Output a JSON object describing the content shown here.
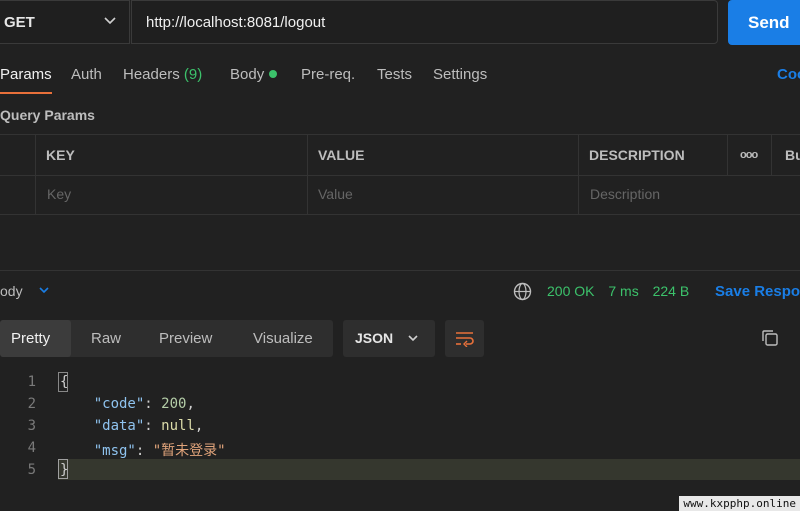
{
  "request": {
    "method": "GET",
    "url": "http://localhost:8081/logout",
    "send_label": "Send"
  },
  "tabs": {
    "params": "Params",
    "auth": "Auth",
    "headers": "Headers",
    "headers_count": "(9)",
    "body": "Body",
    "prereq": "Pre-req.",
    "tests": "Tests",
    "settings": "Settings",
    "cookies": "Coo"
  },
  "query_params": {
    "title": "Query Params",
    "columns": [
      "KEY",
      "VALUE",
      "DESCRIPTION"
    ],
    "more": "ooo",
    "bulk_edit": "Bu",
    "placeholders": {
      "key": "Key",
      "value": "Value",
      "description": "Description"
    }
  },
  "response": {
    "section_label": "ody",
    "status": "200 OK",
    "time": "7 ms",
    "size": "224 B",
    "save_label": "Save Respo",
    "view_tabs": [
      "Pretty",
      "Raw",
      "Preview",
      "Visualize"
    ],
    "format": "JSON",
    "lines": [
      "1",
      "2",
      "3",
      "4",
      "5"
    ],
    "json": {
      "open": "{",
      "k_code": "\"code\"",
      "v_code": "200",
      "k_data": "\"data\"",
      "v_data": "null",
      "k_msg": "\"msg\"",
      "v_msg": "\"暂未登录\"",
      "close": "}"
    }
  },
  "watermark": "www.kxpphp.online",
  "colors": {
    "accent": "#1a7ee6",
    "tab_underline": "#e8703a",
    "status_ok": "#3cc26b"
  }
}
